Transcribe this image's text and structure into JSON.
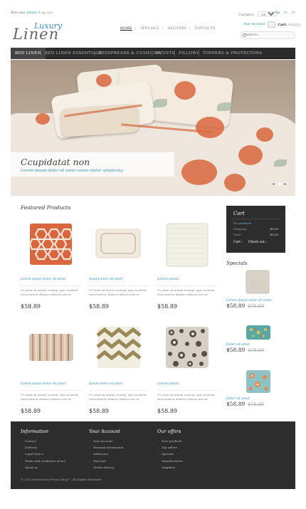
{
  "topbar": {
    "welcome_prefix": "Welcome",
    "user": "Admin",
    "logout": "(Log out)",
    "currency_label": "Currency:",
    "currency_value": "US Dollar",
    "languages": [
      "En",
      "Es",
      "Fr"
    ]
  },
  "logo": {
    "line1": "Luxury",
    "line2": "Linen"
  },
  "header_nav": [
    "HOME",
    "SPECIALS",
    "DELIVERY",
    "CONTACTS"
  ],
  "account": {
    "label": "Your Account"
  },
  "cart_link": {
    "label": "Cart:",
    "state": "(empty)"
  },
  "search": {
    "placeholder": "Search..."
  },
  "main_menu": [
    "BED LINEN",
    "BED LINEN ESSENTIALS",
    "BEDSPREADS & CUSHIONS",
    "DUVETS",
    "PILLOWS",
    "TOPPERS & PROTECTORS"
  ],
  "slider": {
    "title": "Ccupidatat non",
    "subtitle": "Lorem ipsum dolor sit amet conse ctetur adipiscing",
    "slides": 3,
    "active_slide": 2
  },
  "featured": {
    "title": "Featured Products",
    "products": [
      {
        "name": "Lorem ipsum dolor sit amet",
        "desc": "Ut enim ad minim veniam, quis nostrud exercitation ullamco laboris nisi ut.",
        "price": "$58.89",
        "kind": "hexagon-pillow"
      },
      {
        "name": "Ipsum dolor sit amet",
        "desc": "Ut enim ad minim veniam, quis nostrud exercitation ullamco laboris nisi ut.",
        "price": "$58.89",
        "kind": "bordered-pillow"
      },
      {
        "name": "Lorem ipsum",
        "desc": "Ut enim ad minim veniam, quis nostrud exercitation ullamco laboris nisi ut.",
        "price": "$58.89",
        "kind": "quilted-pillow"
      },
      {
        "name": "Lorem ipsum dolor sit amet",
        "desc": "Ut enim ad minim veniam, quis nostrud exercitation ullamco laboris nisi ut.",
        "price": "$58.89",
        "kind": "striped-pillow"
      },
      {
        "name": "Ipsum dolor sit amet",
        "desc": "Ut enim ad minim veniam, quis nostrud exercitation ullamco laboris nisi ut.",
        "price": "$58.89",
        "kind": "chevron-pillow"
      },
      {
        "name": "Lorem ipsum",
        "desc": "Ut enim ad minim veniam, quis nostrud exercitation ullamco laboris nisi ut.",
        "price": "$58.89",
        "kind": "floral-pillow"
      }
    ]
  },
  "cart_box": {
    "title": "Cart",
    "empty_text": "No products",
    "shipping_label": "Shipping",
    "shipping_value": "$0.00",
    "total_label": "Total",
    "total_value": "$0.00",
    "cart_button": "Cart ›",
    "checkout_button": "Check out ›"
  },
  "specials": {
    "title": "Specials",
    "items": [
      {
        "name": "Lorem ipsum dolor sit amet",
        "price": "$58.89",
        "old_price": "$78.89",
        "kind": "plain-pillow"
      },
      {
        "name": "Dolor sit amet",
        "price": "$58.89",
        "old_price": "$78.89",
        "kind": "teal-pillow"
      },
      {
        "name": "Dolor sit amet",
        "price": "$58.89",
        "old_price": "$78.89",
        "kind": "pattern-pillow"
      }
    ]
  },
  "footer": {
    "columns": [
      {
        "title": "Information",
        "links": [
          "Contact",
          "Delivery",
          "Legal Notice",
          "Terms and conditions of use",
          "About us"
        ]
      },
      {
        "title": "Your Account",
        "links": [
          "Your Account",
          "Personal information",
          "Addresses",
          "Discount",
          "Orders history"
        ]
      },
      {
        "title": "Our offers",
        "links": [
          "New products",
          "Top sellers",
          "Specials",
          "Manufacturers",
          "Suppliers"
        ]
      }
    ],
    "copyright": "© 2012 Powered by Presta Shop™. All Rights Reserved"
  },
  "colors": {
    "accent": "#2a8fb8",
    "dark": "#2d2d2d",
    "orange": "#d9663e"
  }
}
